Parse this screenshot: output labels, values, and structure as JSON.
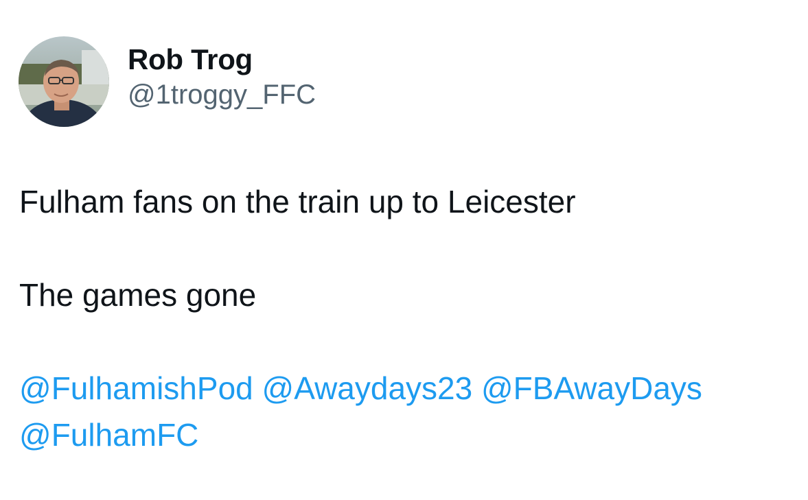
{
  "tweet": {
    "author": {
      "display_name": "Rob Trog",
      "handle": "@1troggy_FFC"
    },
    "lines": [
      "Fulham fans on the train up to Leicester",
      "The games gone"
    ],
    "mentions": [
      "@FulhamishPod",
      "@Awaydays23",
      "@FBAwayDays",
      "@FulhamFC"
    ]
  },
  "colors": {
    "text": "#0f1419",
    "secondary_text": "#536471",
    "link": "#1d9bf0",
    "background": "#ffffff"
  },
  "icons": {
    "avatar": "profile-photo"
  }
}
